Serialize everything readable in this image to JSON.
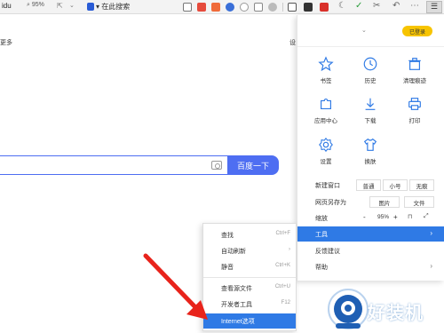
{
  "toolbar": {
    "url_fragment": "idu",
    "zoom": "95%",
    "search_here": "在此搜索"
  },
  "page": {
    "more_link": "更多",
    "settings_fragment": "设",
    "search_button": "百度一下"
  },
  "menu": {
    "login_button": "已登录",
    "grid": [
      {
        "label": "书签",
        "icon": "star-icon"
      },
      {
        "label": "历史",
        "icon": "clock-icon"
      },
      {
        "label": "清理痕迹",
        "icon": "trash-icon"
      },
      {
        "label": "应用中心",
        "icon": "puzzle-icon"
      },
      {
        "label": "下载",
        "icon": "download-icon"
      },
      {
        "label": "打印",
        "icon": "printer-icon"
      },
      {
        "label": "设置",
        "icon": "gear-icon"
      },
      {
        "label": "换肤",
        "icon": "shirt-icon"
      }
    ],
    "new_window": {
      "label": "新建窗口",
      "options": [
        "普通",
        "小号",
        "无痕"
      ]
    },
    "save_page": {
      "label": "网页另存为",
      "options": [
        "图片",
        "文件"
      ]
    },
    "zoom": {
      "label": "缩放",
      "minus": "-",
      "value": "95%",
      "plus": "+"
    },
    "tools": {
      "label": "工具",
      "arrow": "›"
    },
    "feedback": {
      "label": "反馈建议"
    },
    "help": {
      "label": "帮助",
      "arrow": "›"
    }
  },
  "submenu": {
    "items": [
      {
        "label": "查找",
        "shortcut": "Ctrl+F"
      },
      {
        "label": "自动刷新",
        "shortcut": "›"
      },
      {
        "label": "静音",
        "shortcut": "Ctrl+K"
      },
      {
        "label": "查看源文件",
        "shortcut": "Ctrl+U"
      },
      {
        "label": "开发者工具",
        "shortcut": "F12"
      },
      {
        "label": "Internet选项",
        "shortcut": ""
      }
    ]
  },
  "watermark": {
    "text": "好装机"
  },
  "colors": {
    "accent": "#2f7ae5",
    "baidu_blue": "#4e6ef2",
    "login_yellow": "#f7c400",
    "arrow_red": "#e8231b"
  }
}
